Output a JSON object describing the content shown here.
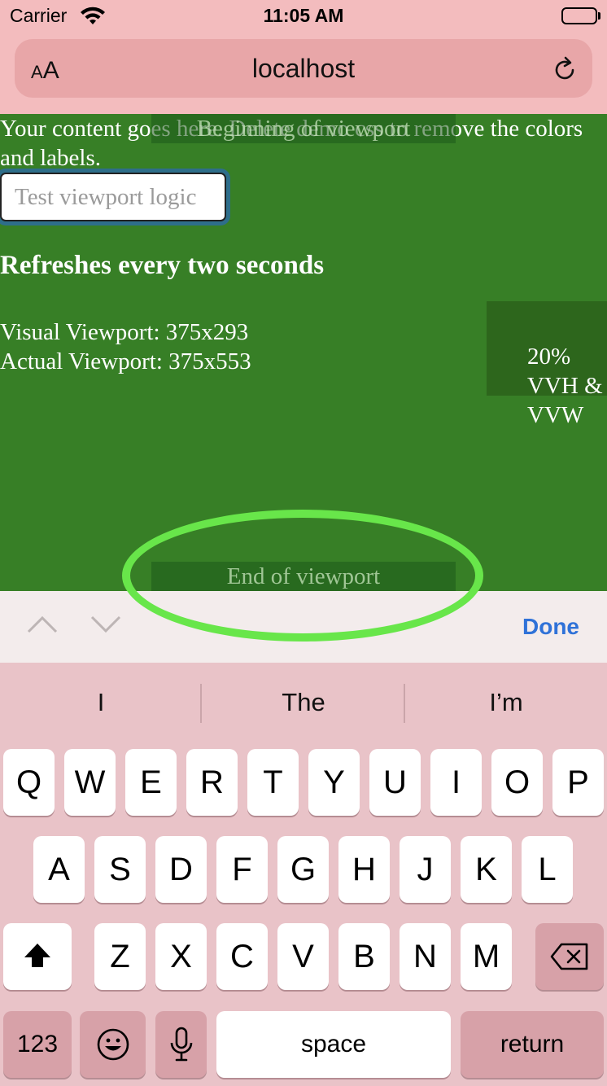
{
  "status_bar": {
    "carrier": "Carrier",
    "time": "11:05 AM"
  },
  "url_bar": {
    "text_size_button": "AA",
    "host": "localhost"
  },
  "page": {
    "intro_text": "Your content goes here. Delete demo css to remove the colors and labels.",
    "begin_label": "Beginning of viewport",
    "test_button": "Test viewport logic",
    "refresh_heading": "Refreshes every two seconds",
    "visual_viewport": "Visual Viewport: 375x293",
    "actual_viewport": "Actual Viewport: 375x553",
    "box_label": "20% VVH & VVW",
    "end_label": "End of viewport"
  },
  "accessory_bar": {
    "done_label": "Done"
  },
  "keyboard": {
    "suggestions": [
      "I",
      "The",
      "I’m"
    ],
    "row1": [
      "Q",
      "W",
      "E",
      "R",
      "T",
      "Y",
      "U",
      "I",
      "O",
      "P"
    ],
    "row2": [
      "A",
      "S",
      "D",
      "F",
      "G",
      "H",
      "J",
      "K",
      "L"
    ],
    "row3": [
      "Z",
      "X",
      "C",
      "V",
      "B",
      "N",
      "M"
    ],
    "numbers_key": "123",
    "space_key": "space",
    "return_key": "return"
  },
  "colors": {
    "page_background": "#377f26",
    "highlight_ellipse": "#68e64a",
    "done_blue": "#2f72d8",
    "browser_chrome": "#f3bcbe"
  }
}
